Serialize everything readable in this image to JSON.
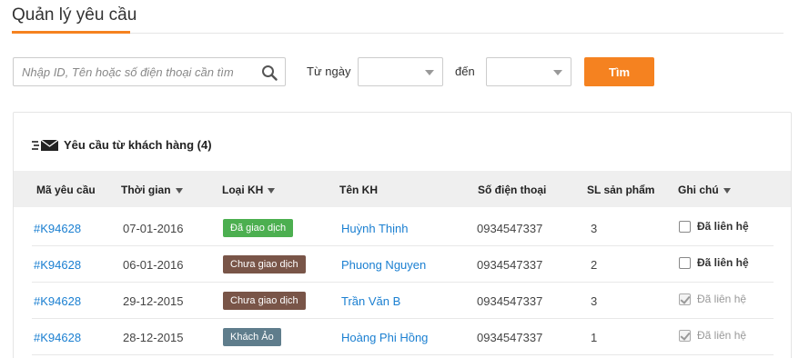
{
  "page": {
    "title": "Quản lý yêu cầu"
  },
  "filters": {
    "search_placeholder": "Nhập ID, Tên hoặc số điện thoại cần tìm",
    "from_label": "Từ ngày",
    "to_label": "đến",
    "from_value": "",
    "to_value": "",
    "search_button": "Tìm"
  },
  "panel": {
    "title": "Yêu cầu từ khách hàng (4)",
    "columns": [
      "Mã yêu cầu",
      "Thời gian",
      "Loại KH",
      "Tên KH",
      "Số điện thoại",
      "SL sản phẩm",
      "Ghi chú"
    ]
  },
  "rows": [
    {
      "id": "#K94628",
      "date": "07-01-2016",
      "type": "Đã giao dịch",
      "type_color": "#4caf50",
      "name": "Huỳnh Thịnh",
      "phone": "0934547337",
      "qty": "3",
      "note": "Đã liên hệ",
      "contacted": false
    },
    {
      "id": "#K94628",
      "date": "06-01-2016",
      "type": "Chưa giao dịch",
      "type_color": "#795548",
      "name": "Phuong Nguyen",
      "phone": "0934547337",
      "qty": "2",
      "note": "Đã liên hệ",
      "contacted": false
    },
    {
      "id": "#K94628",
      "date": "29-12-2015",
      "type": "Chưa giao dịch",
      "type_color": "#795548",
      "name": "Trần Văn B",
      "phone": "0934547337",
      "qty": "3",
      "note": "Đã liên hệ",
      "contacted": true
    },
    {
      "id": "#K94628",
      "date": "28-12-2015",
      "type": "Khách Ảo",
      "type_color": "#5f7d8c",
      "name": "Hoàng Phi Hồng",
      "phone": "0934547337",
      "qty": "1",
      "note": "Đã liên hệ",
      "contacted": true
    }
  ],
  "colors": {
    "accent": "#f58220",
    "link": "#1a7fd1"
  }
}
